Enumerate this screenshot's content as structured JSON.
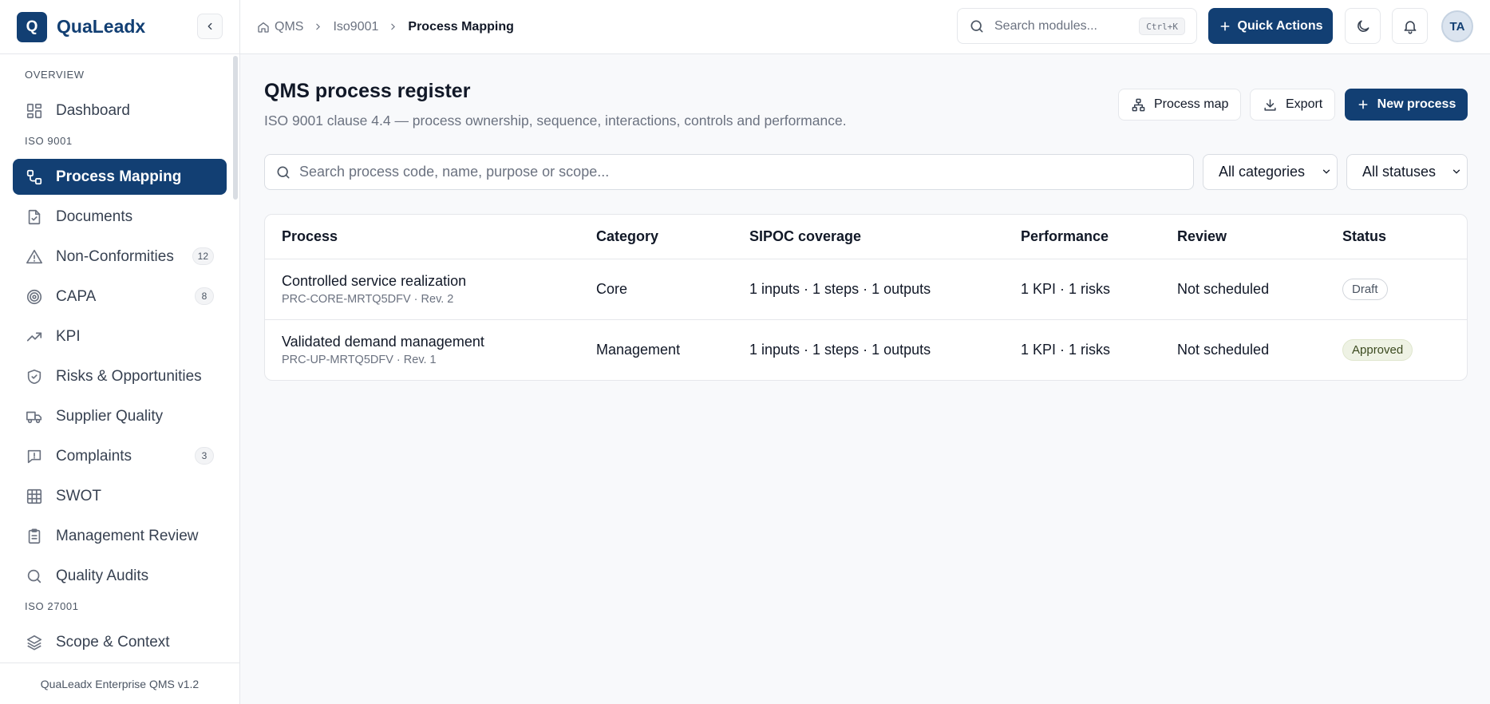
{
  "brand": {
    "logo_letter": "Q",
    "name": "QuaLeadx"
  },
  "sidebar": {
    "sections": [
      {
        "label": "OVERVIEW"
      },
      {
        "label": "ISO 9001"
      },
      {
        "label": "ISO 27001"
      }
    ],
    "items": [
      {
        "label": "Dashboard",
        "icon": "dashboard-grid-icon"
      },
      {
        "label": "Process Mapping",
        "icon": "process-flow-icon",
        "active": true
      },
      {
        "label": "Documents",
        "icon": "document-check-icon"
      },
      {
        "label": "Non-Conformities",
        "icon": "warning-triangle-icon",
        "count": "12"
      },
      {
        "label": "CAPA",
        "icon": "target-icon",
        "count": "8"
      },
      {
        "label": "KPI",
        "icon": "trending-up-icon"
      },
      {
        "label": "Risks & Opportunities",
        "icon": "shield-check-icon"
      },
      {
        "label": "Supplier Quality",
        "icon": "truck-icon"
      },
      {
        "label": "Complaints",
        "icon": "message-alert-icon",
        "count": "3"
      },
      {
        "label": "SWOT",
        "icon": "grid-table-icon"
      },
      {
        "label": "Management Review",
        "icon": "clipboard-icon"
      },
      {
        "label": "Quality Audits",
        "icon": "search-icon"
      },
      {
        "label": "Scope & Context",
        "icon": "layers-icon"
      }
    ],
    "footer": "QuaLeadx Enterprise QMS v1.2"
  },
  "topbar": {
    "breadcrumb": [
      "QMS",
      "Iso9001",
      "Process Mapping"
    ],
    "search_placeholder": "Search modules...",
    "search_shortcut": "Ctrl+K",
    "quick_actions": "Quick Actions",
    "avatar_initials": "TA"
  },
  "page": {
    "title": "QMS process register",
    "subtitle": "ISO 9001 clause 4.4 — process ownership, sequence, interactions, controls and performance.",
    "buttons": {
      "process_map": "Process map",
      "export": "Export",
      "new_process": "New process"
    },
    "filter": {
      "search_placeholder": "Search process code, name, purpose or scope...",
      "category": "All categories",
      "status": "All statuses"
    }
  },
  "table": {
    "headers": [
      "Process",
      "Category",
      "SIPOC coverage",
      "Performance",
      "Review",
      "Status"
    ],
    "rows": [
      {
        "name": "Controlled service realization",
        "code": "PRC-CORE-MRTQ5DFV · Rev. 2",
        "category": "Core",
        "sipoc": "1 inputs · 1 steps · 1 outputs",
        "performance": "1 KPI · 1 risks",
        "review": "Not scheduled",
        "status": "Draft"
      },
      {
        "name": "Validated demand management",
        "code": "PRC-UP-MRTQ5DFV · Rev. 1",
        "category": "Management",
        "sipoc": "1 inputs · 1 steps · 1 outputs",
        "performance": "1 KPI · 1 risks",
        "review": "Not scheduled",
        "status": "Approved"
      }
    ]
  },
  "colors": {
    "brand": "#123f73",
    "draft_badge": "#ffffff",
    "approved_badge": "#eef2e4"
  }
}
